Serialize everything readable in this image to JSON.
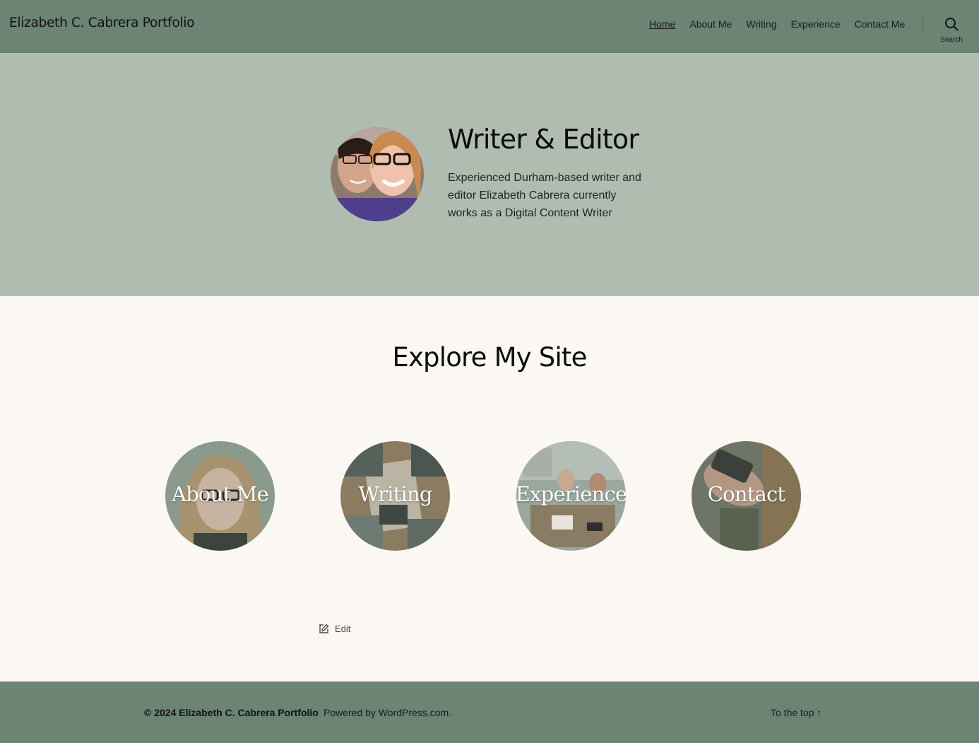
{
  "header": {
    "site_title": "Elizabeth C. Cabrera Portfolio",
    "nav": [
      {
        "label": "Home",
        "current": true
      },
      {
        "label": "About Me"
      },
      {
        "label": "Writing"
      },
      {
        "label": "Experience"
      },
      {
        "label": "Contact Me"
      }
    ],
    "search_label": "Search"
  },
  "hero": {
    "title": "Writer & Editor",
    "text": "Experienced Durham-based writer and editor Elizabeth Cabrera currently works as a Digital Content Writer"
  },
  "explore": {
    "title": "Explore My Site",
    "cards": [
      {
        "label": "About Me"
      },
      {
        "label": "Writing"
      },
      {
        "label": "Experience"
      },
      {
        "label": "Contact"
      }
    ]
  },
  "edit": {
    "label": "Edit"
  },
  "footer": {
    "copyright": "© 2024 Elizabeth C. Cabrera Portfolio",
    "powered": "Powered by WordPress.com.",
    "to_top": "To the top ↑"
  },
  "colors": {
    "header_bg": "#6b8474",
    "hero_bg": "#b1bcb1",
    "page_bg": "#fbf8f4"
  }
}
